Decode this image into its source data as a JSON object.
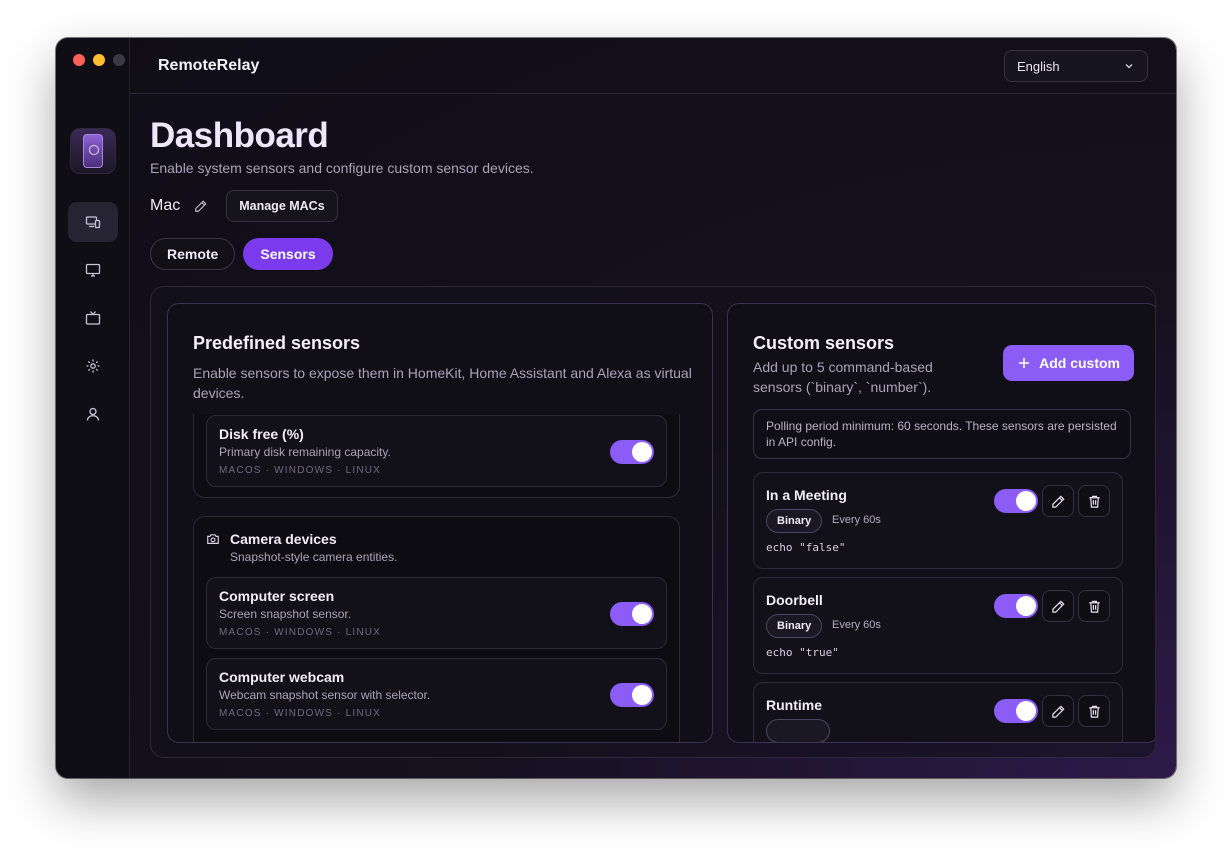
{
  "app": {
    "name": "RemoteRelay"
  },
  "language": {
    "selected": "English"
  },
  "sidebar": {
    "items": [
      {
        "name": "devices",
        "icon": "devices-icon",
        "active": true
      },
      {
        "name": "display",
        "icon": "monitor-icon",
        "active": false
      },
      {
        "name": "tv",
        "icon": "tv-icon",
        "active": false
      },
      {
        "name": "settings",
        "icon": "gear-icon",
        "active": false
      },
      {
        "name": "account",
        "icon": "user-icon",
        "active": false
      }
    ]
  },
  "page": {
    "title": "Dashboard",
    "subtitle": "Enable system sensors and configure custom sensor devices.",
    "mac_name": "Mac",
    "manage_macs_label": "Manage MACs"
  },
  "tabs": [
    {
      "label": "Remote",
      "active": false
    },
    {
      "label": "Sensors",
      "active": true
    }
  ],
  "predefined": {
    "title": "Predefined sensors",
    "description": "Enable sensors to expose them in HomeKit, Home Assistant and Alexa as virtual devices.",
    "disk": {
      "title": "Disk free (%)",
      "description": "Primary disk remaining capacity.",
      "os": "MACOS · WINDOWS · LINUX",
      "enabled": true
    },
    "camera_group": {
      "title": "Camera devices",
      "description": "Snapshot-style camera entities.",
      "items": [
        {
          "title": "Computer screen",
          "description": "Screen snapshot sensor.",
          "os": "MACOS · WINDOWS · LINUX",
          "enabled": true
        },
        {
          "title": "Computer webcam",
          "description": "Webcam snapshot sensor with selector.",
          "os": "MACOS · WINDOWS · LINUX",
          "enabled": true
        }
      ]
    }
  },
  "custom": {
    "title": "Custom sensors",
    "description": "Add up to 5 command-based sensors (`binary`, `number`).",
    "add_label": "Add custom",
    "notice": "Polling period minimum: 60 seconds. These sensors are persisted in API config.",
    "sensors": [
      {
        "title": "In a Meeting",
        "type": "Binary",
        "interval": "Every 60s",
        "command": "echo \"false\"",
        "enabled": true
      },
      {
        "title": "Doorbell",
        "type": "Binary",
        "interval": "Every 60s",
        "command": "echo \"true\"",
        "enabled": true
      },
      {
        "title": "Runtime",
        "type": "",
        "interval": "",
        "command": "",
        "enabled": true
      }
    ]
  },
  "colors": {
    "accent": "#8b5cf6",
    "accent_active_tab": "#7c3aed"
  }
}
